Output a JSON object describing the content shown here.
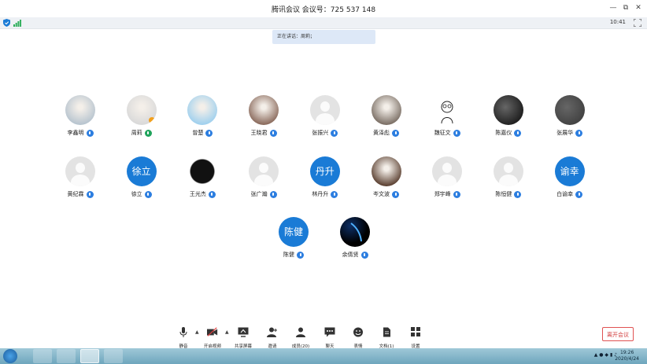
{
  "window": {
    "title": "腾讯会议  会议号：725 537 148",
    "minimize": "—",
    "restore": "⧉",
    "close": "✕"
  },
  "status_bar": {
    "time": "10:41",
    "shield_icon": "shield-icon",
    "signal_icon": "signal-icon",
    "fullscreen_icon": "fullscreen-icon"
  },
  "speaking": {
    "text": "正在讲话：周莉；"
  },
  "participants": [
    {
      "name": "李鑫明",
      "avatar": "photo",
      "mic": "blue"
    },
    {
      "name": "周莉",
      "avatar": "photo",
      "mic": "green"
    },
    {
      "name": "曾楚",
      "avatar": "photo",
      "mic": "blue"
    },
    {
      "name": "王晓君",
      "avatar": "photo",
      "mic": "blue"
    },
    {
      "name": "张振兴",
      "avatar": "default",
      "mic": "blue"
    },
    {
      "name": "黄泽彪",
      "avatar": "photo",
      "mic": "blue"
    },
    {
      "name": "魏征文",
      "avatar": "sketch",
      "mic": "blue"
    },
    {
      "name": "陈嘉仪",
      "avatar": "dark",
      "mic": "blue"
    },
    {
      "name": "张展华",
      "avatar": "dark",
      "mic": "blue"
    },
    {
      "name": "黄纪霖",
      "avatar": "default",
      "mic": "blue"
    },
    {
      "name": "徐立",
      "avatar": "initials",
      "initials": "徐立",
      "mic": "blue"
    },
    {
      "name": "王光杰",
      "avatar": "sketch-dark",
      "mic": "blue"
    },
    {
      "name": "张广瀚",
      "avatar": "default",
      "mic": "blue"
    },
    {
      "name": "林丹升",
      "avatar": "initials",
      "initials": "丹升",
      "mic": "blue"
    },
    {
      "name": "岑文波",
      "avatar": "photo",
      "mic": "blue"
    },
    {
      "name": "郑宇峰",
      "avatar": "default",
      "mic": "blue"
    },
    {
      "name": "陈恒健",
      "avatar": "default",
      "mic": "blue"
    },
    {
      "name": "白谕幸",
      "avatar": "initials",
      "initials": "谕幸",
      "mic": "blue"
    },
    {
      "name": "陈健",
      "avatar": "initials",
      "initials": "陈健",
      "mic": "blue"
    },
    {
      "name": "余倩贤",
      "avatar": "comet",
      "mic": "blue"
    }
  ],
  "toolbar": {
    "mute": "静音",
    "video": "开启视频",
    "share": "共享屏幕",
    "invite": "邀请",
    "members": "成员(20)",
    "chat": "聊天",
    "reaction": "表情",
    "docs": "文档(1)",
    "settings": "设置",
    "leave": "离开会议"
  },
  "taskbar": {
    "clock_time": "19:26",
    "clock_date": "2020/4/24"
  },
  "colors": {
    "accent": "#1a7bd6",
    "leave": "#d23f3f",
    "speaking_bg": "#dde8f7"
  }
}
